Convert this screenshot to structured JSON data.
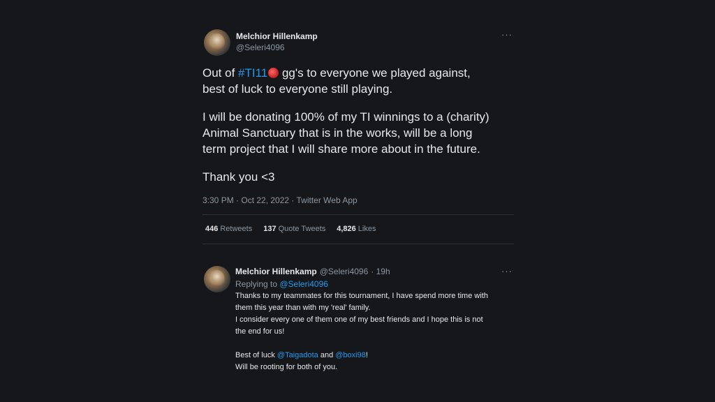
{
  "tweet": {
    "author_name": "Melchior Hillenkamp",
    "author_handle": "@Seleri4096",
    "more_icon": "···",
    "text": {
      "line1_pre": "Out of ",
      "hashtag": "#TI11",
      "line1_post": " gg's to everyone we played against,",
      "line2": "best of luck to everyone still playing.",
      "line3": "I will be donating 100% of my TI winnings to a (charity)",
      "line4": "Animal Sanctuary that is in the works, will be a long",
      "line5": "term project that I will share more about in the future.",
      "line6": "Thank you <3"
    },
    "meta": "3:30 PM · Oct 22, 2022 · Twitter Web App",
    "stats": {
      "retweets_count": "446",
      "retweets_label": "Retweets",
      "quotes_count": "137",
      "quotes_label": "Quote Tweets",
      "likes_count": "4,826",
      "likes_label": "Likes"
    }
  },
  "reply": {
    "author_name": "Melchior Hillenkamp",
    "author_handle": "@Seleri4096",
    "time": "· 19h",
    "more_icon": "···",
    "replying_label": "Replying to ",
    "replying_handle": "@Seleri4096",
    "lines": {
      "l1": "Thanks to my teammates for this tournament, I have spend more time with",
      "l2": "them this year than with my 'real' family.",
      "l3": "I consider every one of them one of my best friends and I hope this is not",
      "l4": "the end for us!",
      "l5_pre": "Best of luck ",
      "l5_mention1": "@Taigadota",
      "l5_mid": " and ",
      "l5_mention2": "@boxi98",
      "l5_post": "!",
      "l6": "Will be rooting for both of you."
    }
  },
  "colors": {
    "background": "#16171a",
    "link": "#1d9bf0",
    "text": "#e7e9ea",
    "muted": "#8b98a5"
  }
}
